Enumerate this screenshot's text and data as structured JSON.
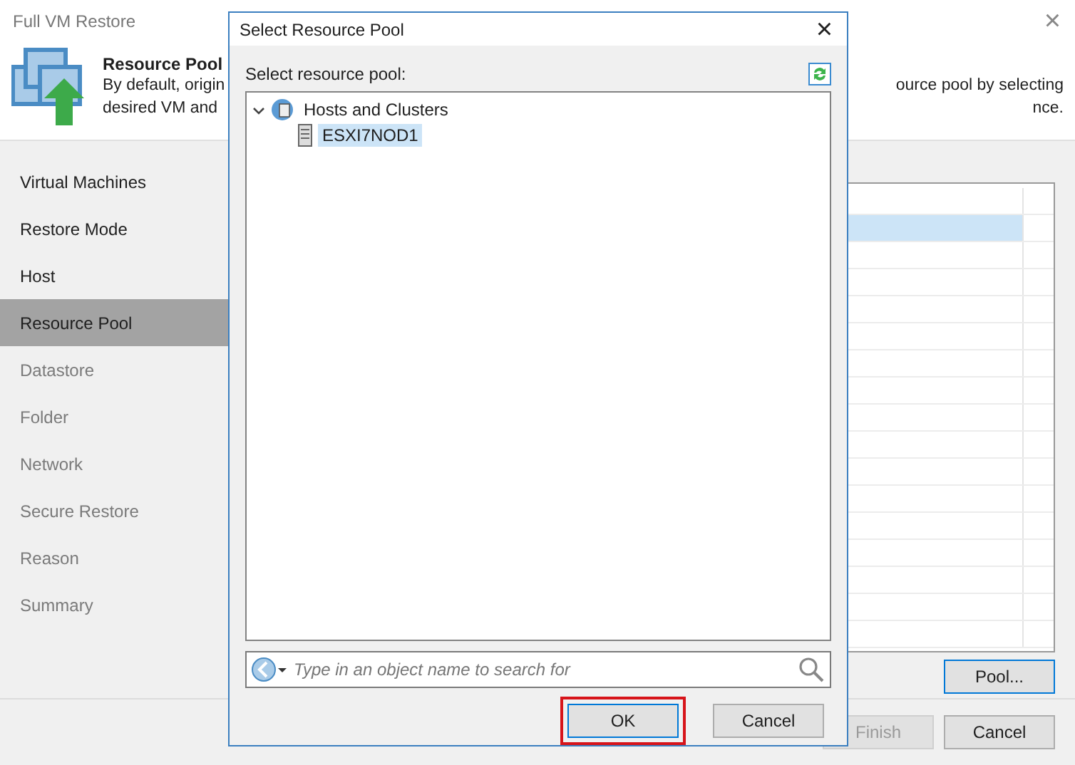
{
  "window": {
    "title": "Full VM Restore",
    "close": "×"
  },
  "header": {
    "title": "Resource Pool",
    "desc_left": [
      "By default, origin",
      "desired VM and"
    ],
    "desc_right": [
      "ource pool by selecting",
      "nce."
    ]
  },
  "steps": [
    {
      "label": "Virtual Machines",
      "selected": false,
      "disabled": false
    },
    {
      "label": "Restore Mode",
      "selected": false,
      "disabled": false
    },
    {
      "label": "Host",
      "selected": false,
      "disabled": false
    },
    {
      "label": "Resource Pool",
      "selected": true,
      "disabled": false
    },
    {
      "label": "Datastore",
      "selected": false,
      "disabled": true
    },
    {
      "label": "Folder",
      "selected": false,
      "disabled": true
    },
    {
      "label": "Network",
      "selected": false,
      "disabled": true
    },
    {
      "label": "Secure Restore",
      "selected": false,
      "disabled": true
    },
    {
      "label": "Reason",
      "selected": false,
      "disabled": true
    },
    {
      "label": "Summary",
      "selected": false,
      "disabled": true
    }
  ],
  "table": {
    "rows": [
      {
        "selected": false
      },
      {
        "selected": true
      },
      {
        "selected": false
      },
      {
        "selected": false
      },
      {
        "selected": false
      },
      {
        "selected": false
      },
      {
        "selected": false
      },
      {
        "selected": false
      },
      {
        "selected": false
      },
      {
        "selected": false
      },
      {
        "selected": false
      },
      {
        "selected": false
      },
      {
        "selected": false
      },
      {
        "selected": false
      },
      {
        "selected": false
      },
      {
        "selected": false
      },
      {
        "selected": false
      }
    ]
  },
  "pool_button": "Pool...",
  "buttons": [
    {
      "label": "Finish",
      "disabled": true
    },
    {
      "label": "Cancel",
      "disabled": false
    }
  ],
  "dialog": {
    "title": "Select Resource Pool",
    "close": "×",
    "label": "Select resource pool:",
    "tree": [
      {
        "label": "Hosts and Clusters",
        "kind": "root",
        "expanded": true,
        "selected": false,
        "children": [
          {
            "label": "ESXI7NOD1",
            "kind": "host",
            "selected": true
          }
        ]
      }
    ],
    "search": {
      "placeholder": "Type in an object name to search for"
    },
    "buttons": [
      {
        "label": "OK",
        "default": true,
        "highlighted": true
      },
      {
        "label": "Cancel",
        "default": false,
        "highlighted": false
      }
    ]
  }
}
